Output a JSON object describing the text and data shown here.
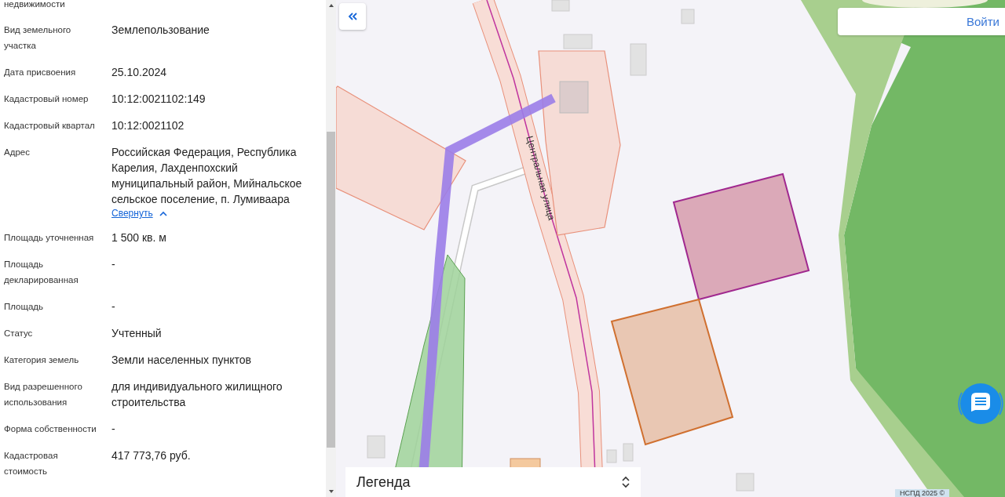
{
  "details": {
    "rows": [
      {
        "label": "недвижимости"
      },
      {
        "label": "Вид земельного участка",
        "value": "Землепользование"
      },
      {
        "label": "Дата присвоения",
        "value": "25.10.2024"
      },
      {
        "label": "Кадастровый номер",
        "value": "10:12:0021102:149"
      },
      {
        "label": "Кадастровый квартал",
        "value": "10:12:0021102"
      },
      {
        "label": "Адрес",
        "value": "Российская Федерация, Республика Карелия, Лахденпохский муниципальный район, Мийнальское сельское поселение, п. Лумиваара",
        "link": "Свернуть"
      },
      {
        "label": "Площадь уточненная",
        "value": "1 500 кв. м"
      },
      {
        "label": "Площадь декларированная",
        "value": "-"
      },
      {
        "label": "Площадь",
        "value": "-"
      },
      {
        "label": "Статус",
        "value": "Учтенный"
      },
      {
        "label": "Категория земель",
        "value": "Земли населенных пунктов"
      },
      {
        "label": "Вид разрешенного использования",
        "value": "для индивидуального жилищного строительства"
      },
      {
        "label": "Форма собственности",
        "value": "-"
      },
      {
        "label": "Кадастровая стоимость",
        "value": "417 773,76 руб."
      }
    ]
  },
  "map": {
    "street_label": "Центральная улица",
    "login_button": "Войти",
    "legend": "Легенда",
    "attribution": "НСПД 2025 ©"
  }
}
